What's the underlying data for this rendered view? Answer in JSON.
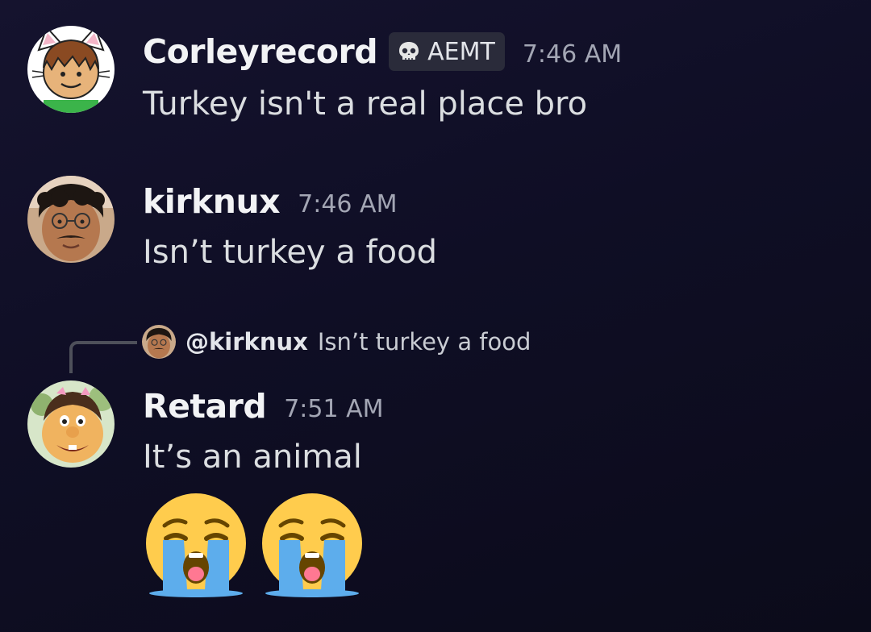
{
  "messages": [
    {
      "username": "Corleyrecord",
      "badge": {
        "label": "AEMT",
        "icon": "skull-icon"
      },
      "timestamp": "7:46 AM",
      "text": "Turkey isn't a real place bro"
    },
    {
      "username": "kirknux",
      "timestamp": "7:46 AM",
      "text": "Isn’t turkey a food"
    },
    {
      "username": "Retard",
      "timestamp": "7:51 AM",
      "text": "It’s an animal",
      "reply": {
        "username": "@kirknux",
        "text": "Isn’t turkey a food"
      },
      "emojis": [
        "loudly-crying-face-emoji",
        "loudly-crying-face-emoji"
      ]
    }
  ],
  "colors": {
    "background": "#13122b",
    "username": "#f2f3f5",
    "text": "#dbdee1",
    "timestamp": "#a3a6b4",
    "badge_bg": "#2a2b3a"
  }
}
